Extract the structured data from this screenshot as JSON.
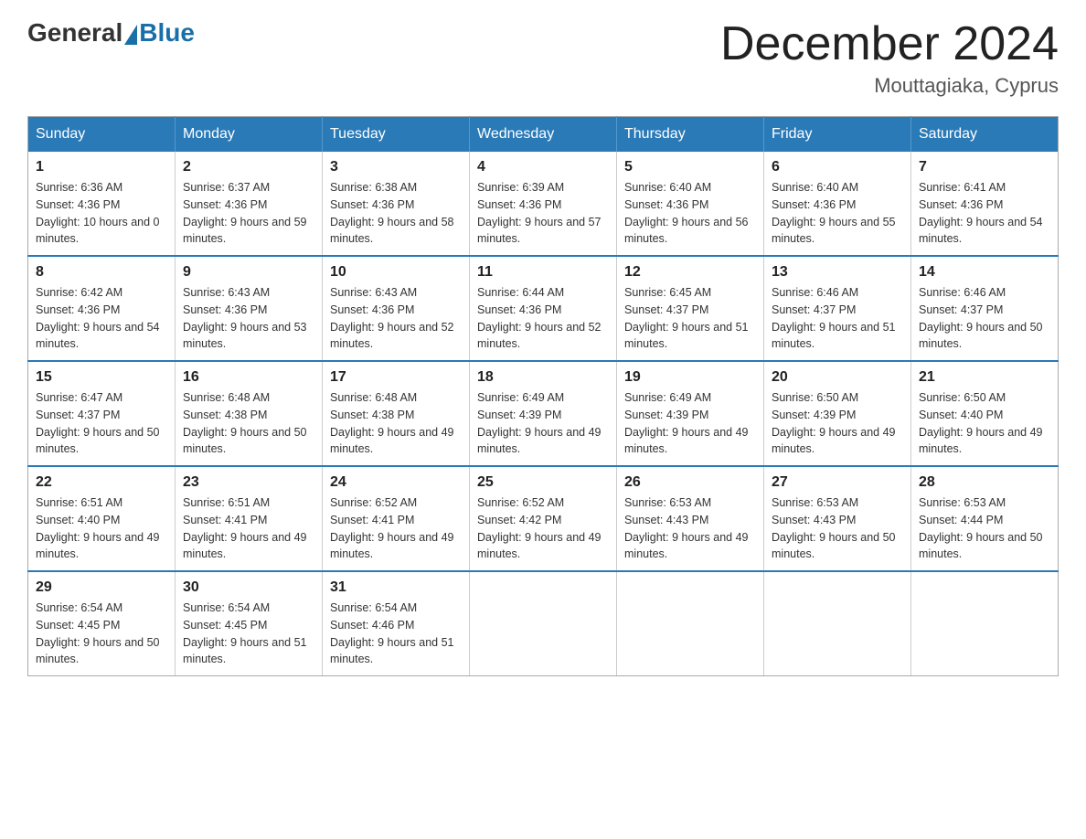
{
  "header": {
    "logo_general": "General",
    "logo_blue": "Blue",
    "month_year": "December 2024",
    "location": "Mouttagiaka, Cyprus"
  },
  "days_of_week": [
    "Sunday",
    "Monday",
    "Tuesday",
    "Wednesday",
    "Thursday",
    "Friday",
    "Saturday"
  ],
  "weeks": [
    [
      {
        "day": "1",
        "sunrise": "6:36 AM",
        "sunset": "4:36 PM",
        "daylight": "10 hours and 0 minutes."
      },
      {
        "day": "2",
        "sunrise": "6:37 AM",
        "sunset": "4:36 PM",
        "daylight": "9 hours and 59 minutes."
      },
      {
        "day": "3",
        "sunrise": "6:38 AM",
        "sunset": "4:36 PM",
        "daylight": "9 hours and 58 minutes."
      },
      {
        "day": "4",
        "sunrise": "6:39 AM",
        "sunset": "4:36 PM",
        "daylight": "9 hours and 57 minutes."
      },
      {
        "day": "5",
        "sunrise": "6:40 AM",
        "sunset": "4:36 PM",
        "daylight": "9 hours and 56 minutes."
      },
      {
        "day": "6",
        "sunrise": "6:40 AM",
        "sunset": "4:36 PM",
        "daylight": "9 hours and 55 minutes."
      },
      {
        "day": "7",
        "sunrise": "6:41 AM",
        "sunset": "4:36 PM",
        "daylight": "9 hours and 54 minutes."
      }
    ],
    [
      {
        "day": "8",
        "sunrise": "6:42 AM",
        "sunset": "4:36 PM",
        "daylight": "9 hours and 54 minutes."
      },
      {
        "day": "9",
        "sunrise": "6:43 AM",
        "sunset": "4:36 PM",
        "daylight": "9 hours and 53 minutes."
      },
      {
        "day": "10",
        "sunrise": "6:43 AM",
        "sunset": "4:36 PM",
        "daylight": "9 hours and 52 minutes."
      },
      {
        "day": "11",
        "sunrise": "6:44 AM",
        "sunset": "4:36 PM",
        "daylight": "9 hours and 52 minutes."
      },
      {
        "day": "12",
        "sunrise": "6:45 AM",
        "sunset": "4:37 PM",
        "daylight": "9 hours and 51 minutes."
      },
      {
        "day": "13",
        "sunrise": "6:46 AM",
        "sunset": "4:37 PM",
        "daylight": "9 hours and 51 minutes."
      },
      {
        "day": "14",
        "sunrise": "6:46 AM",
        "sunset": "4:37 PM",
        "daylight": "9 hours and 50 minutes."
      }
    ],
    [
      {
        "day": "15",
        "sunrise": "6:47 AM",
        "sunset": "4:37 PM",
        "daylight": "9 hours and 50 minutes."
      },
      {
        "day": "16",
        "sunrise": "6:48 AM",
        "sunset": "4:38 PM",
        "daylight": "9 hours and 50 minutes."
      },
      {
        "day": "17",
        "sunrise": "6:48 AM",
        "sunset": "4:38 PM",
        "daylight": "9 hours and 49 minutes."
      },
      {
        "day": "18",
        "sunrise": "6:49 AM",
        "sunset": "4:39 PM",
        "daylight": "9 hours and 49 minutes."
      },
      {
        "day": "19",
        "sunrise": "6:49 AM",
        "sunset": "4:39 PM",
        "daylight": "9 hours and 49 minutes."
      },
      {
        "day": "20",
        "sunrise": "6:50 AM",
        "sunset": "4:39 PM",
        "daylight": "9 hours and 49 minutes."
      },
      {
        "day": "21",
        "sunrise": "6:50 AM",
        "sunset": "4:40 PM",
        "daylight": "9 hours and 49 minutes."
      }
    ],
    [
      {
        "day": "22",
        "sunrise": "6:51 AM",
        "sunset": "4:40 PM",
        "daylight": "9 hours and 49 minutes."
      },
      {
        "day": "23",
        "sunrise": "6:51 AM",
        "sunset": "4:41 PM",
        "daylight": "9 hours and 49 minutes."
      },
      {
        "day": "24",
        "sunrise": "6:52 AM",
        "sunset": "4:41 PM",
        "daylight": "9 hours and 49 minutes."
      },
      {
        "day": "25",
        "sunrise": "6:52 AM",
        "sunset": "4:42 PM",
        "daylight": "9 hours and 49 minutes."
      },
      {
        "day": "26",
        "sunrise": "6:53 AM",
        "sunset": "4:43 PM",
        "daylight": "9 hours and 49 minutes."
      },
      {
        "day": "27",
        "sunrise": "6:53 AM",
        "sunset": "4:43 PM",
        "daylight": "9 hours and 50 minutes."
      },
      {
        "day": "28",
        "sunrise": "6:53 AM",
        "sunset": "4:44 PM",
        "daylight": "9 hours and 50 minutes."
      }
    ],
    [
      {
        "day": "29",
        "sunrise": "6:54 AM",
        "sunset": "4:45 PM",
        "daylight": "9 hours and 50 minutes."
      },
      {
        "day": "30",
        "sunrise": "6:54 AM",
        "sunset": "4:45 PM",
        "daylight": "9 hours and 51 minutes."
      },
      {
        "day": "31",
        "sunrise": "6:54 AM",
        "sunset": "4:46 PM",
        "daylight": "9 hours and 51 minutes."
      },
      null,
      null,
      null,
      null
    ]
  ]
}
